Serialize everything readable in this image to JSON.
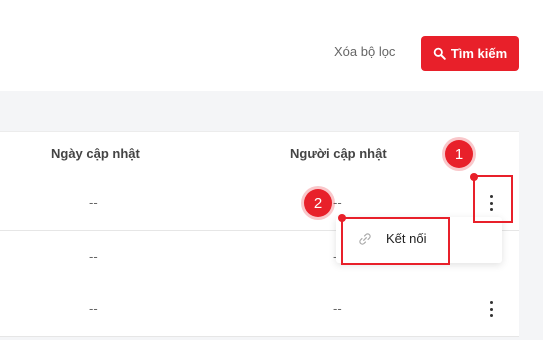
{
  "filter": {
    "clear_label": "Xóa bộ lọc",
    "search_label": "Tìm kiếm",
    "search_icon": "search-icon"
  },
  "table": {
    "columns": [
      "Ngày cập nhật",
      "Người cập nhật"
    ],
    "rows": [
      {
        "updated_date": "--",
        "updated_by": "--"
      },
      {
        "updated_date": "--",
        "updated_by": "--"
      },
      {
        "updated_date": "--",
        "updated_by": "--"
      }
    ]
  },
  "dropdown": {
    "items": [
      {
        "label": "Kết nối",
        "icon": "link-icon"
      }
    ]
  },
  "annotations": {
    "step1": "1",
    "step2": "2"
  },
  "colors": {
    "accent": "#e8202a"
  }
}
